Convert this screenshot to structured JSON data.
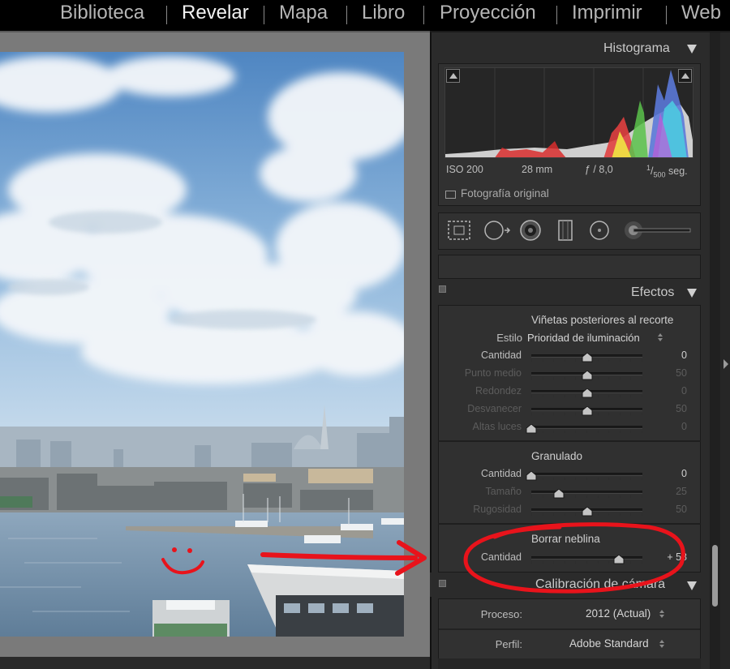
{
  "modules": [
    {
      "label": "Biblioteca",
      "active": false
    },
    {
      "label": "Revelar",
      "active": true
    },
    {
      "label": "Mapa",
      "active": false
    },
    {
      "label": "Libro",
      "active": false
    },
    {
      "label": "Proyección",
      "active": false
    },
    {
      "label": "Imprimir",
      "active": false
    },
    {
      "label": "Web",
      "active": false
    }
  ],
  "histogram": {
    "title": "Histograma",
    "iso": "ISO 200",
    "focal": "28 mm",
    "aperture": "ƒ / 8,0",
    "shutter_num": "1",
    "shutter_den": "500",
    "shutter_unit": "seg.",
    "original_label": "Fotografía original"
  },
  "effects": {
    "title": "Efectos",
    "vignette": {
      "title": "Viñetas posteriores al recorte",
      "style_label": "Estilo",
      "style_value": "Prioridad de iluminación",
      "sliders": [
        {
          "label": "Cantidad",
          "value": "0",
          "position": 0.5,
          "enabled": true
        },
        {
          "label": "Punto medio",
          "value": "50",
          "position": 0.5,
          "enabled": false
        },
        {
          "label": "Redondez",
          "value": "0",
          "position": 0.5,
          "enabled": false
        },
        {
          "label": "Desvanecer",
          "value": "50",
          "position": 0.5,
          "enabled": false
        },
        {
          "label": "Altas luces",
          "value": "0",
          "position": 0.0,
          "enabled": false
        }
      ]
    },
    "grain": {
      "title": "Granulado",
      "sliders": [
        {
          "label": "Cantidad",
          "value": "0",
          "position": 0.0,
          "enabled": true
        },
        {
          "label": "Tamaño",
          "value": "25",
          "position": 0.25,
          "enabled": false
        },
        {
          "label": "Rugosidad",
          "value": "50",
          "position": 0.5,
          "enabled": false
        }
      ]
    },
    "dehaze": {
      "title": "Borrar neblina",
      "sliders": [
        {
          "label": "Cantidad",
          "value": "+ 58",
          "position": 0.79,
          "enabled": true
        }
      ]
    }
  },
  "calibration": {
    "title": "Calibración de cámara",
    "process_label": "Proceso:",
    "process_value": "2012 (Actual)",
    "profile_label": "Perfil:",
    "profile_value": "Adobe Standard"
  },
  "colors": {
    "annotation": "#e8131b",
    "panel": "#2b2b2b",
    "subpanel": "#303030"
  }
}
